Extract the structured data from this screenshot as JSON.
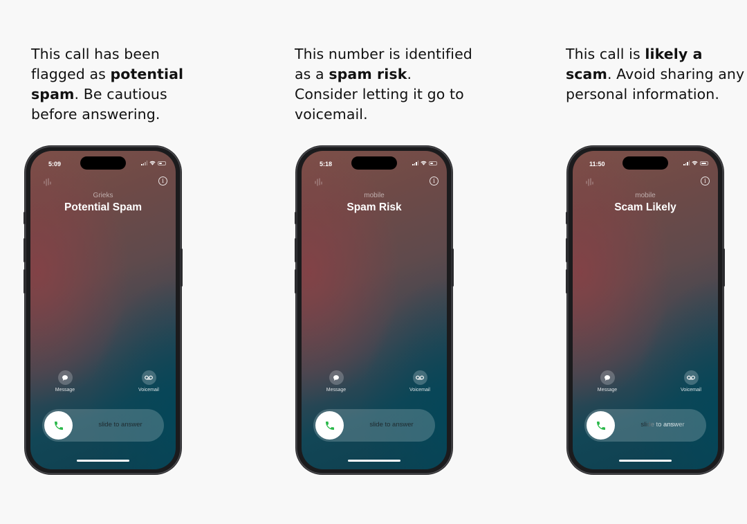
{
  "panels": [
    {
      "caption": {
        "pre": "This call has been flagged as ",
        "bold": "potential spam",
        "post": ". Be cautious before answering."
      },
      "phone": {
        "time": "5:09",
        "battery_level": 0.5,
        "caller_subtitle": "Grieks",
        "caller_title": "Potential Spam",
        "actions": {
          "message": "Message",
          "voicemail": "Voicemail"
        },
        "slider_text": "slide to answer"
      }
    },
    {
      "caption": {
        "pre": "This number is identified as a ",
        "bold": "spam risk",
        "post": ". Consider letting it go to voicemail."
      },
      "phone": {
        "time": "5:18",
        "battery_level": 0.5,
        "caller_subtitle": "mobile",
        "caller_title": "Spam Risk",
        "actions": {
          "message": "Message",
          "voicemail": "Voicemail"
        },
        "slider_text": "slide to answer"
      }
    },
    {
      "caption": {
        "pre": "This call is ",
        "bold": "likely a scam",
        "post": ". Avoid sharing any personal information."
      },
      "phone": {
        "time": "11:50",
        "battery_level": 0.9,
        "caller_subtitle": "mobile",
        "caller_title": "Scam Likely",
        "actions": {
          "message": "Message",
          "voicemail": "Voicemail"
        },
        "slider_text": "slide to answer"
      }
    }
  ],
  "colors": {
    "page_bg": "#f8f8f8",
    "answer_green": "#2bb84a",
    "gradient_warm": "#7c5048",
    "gradient_teal": "#0e3f4f"
  }
}
